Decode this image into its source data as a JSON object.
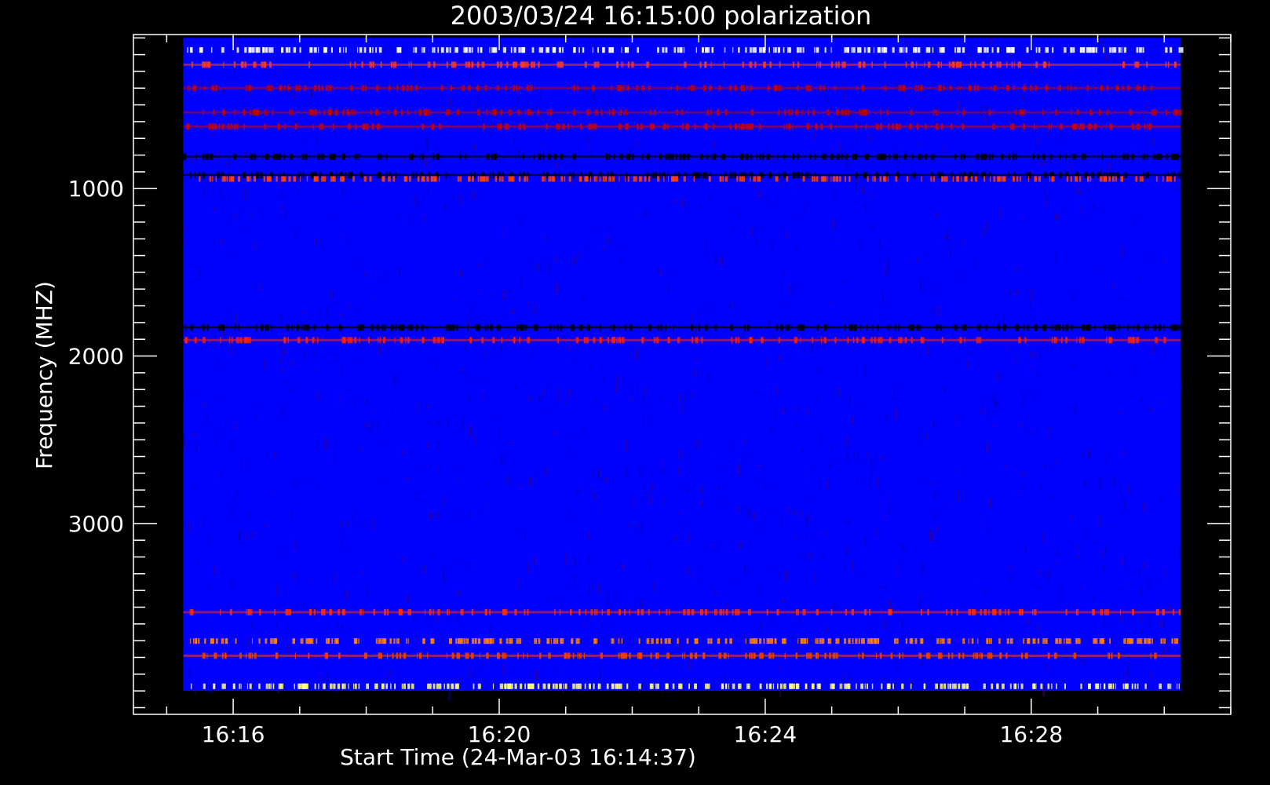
{
  "chart_data": {
    "type": "heatmap",
    "title": "2003/03/24 16:15:00 polarization",
    "xlabel": "Start Time (24-Mar-03 16:14:37)",
    "ylabel": "Frequency (MHZ)",
    "x_start": "16:14:37",
    "xlim": [
      "16:14:30",
      "16:31:00"
    ],
    "ylim": [
      4140,
      80
    ],
    "y_inverted": true,
    "grid": false,
    "data_x_range": [
      "16:15:15",
      "16:30:15"
    ],
    "data_y_range": [
      100,
      4000
    ],
    "x_ticks": [
      "16:16",
      "16:20",
      "16:24",
      "16:28"
    ],
    "y_ticks": [
      1000,
      2000,
      3000
    ],
    "y_minor_step": 100,
    "colors": {
      "background": "#000000",
      "axes": "#ffffff",
      "low": "#0000ff",
      "mid": "#ff0000",
      "high": "#ffff80"
    },
    "features": [
      {
        "freq": 170,
        "kind": "speckle",
        "color": "#ffffff"
      },
      {
        "freq": 260,
        "kind": "line",
        "color": "#ff4000"
      },
      {
        "freq": 400,
        "kind": "line",
        "color": "#c00000"
      },
      {
        "freq": 545,
        "kind": "line",
        "color": "#c00000"
      },
      {
        "freq": 630,
        "kind": "line",
        "color": "#d00000"
      },
      {
        "freq": 810,
        "kind": "dark-line",
        "color": "#000000"
      },
      {
        "freq": 920,
        "kind": "dark-line",
        "color": "#000000"
      },
      {
        "freq": 940,
        "kind": "speckle",
        "color": "#ff4000"
      },
      {
        "freq": 1830,
        "kind": "dark-line",
        "color": "#000000"
      },
      {
        "freq": 1905,
        "kind": "line",
        "color": "#ff2000"
      },
      {
        "freq": 3530,
        "kind": "line",
        "color": "#ff3000"
      },
      {
        "freq": 3700,
        "kind": "speckle",
        "color": "#ff8000"
      },
      {
        "freq": 3790,
        "kind": "line",
        "color": "#ff4000"
      },
      {
        "freq": 3970,
        "kind": "speckle",
        "color": "#ffff80"
      }
    ]
  }
}
